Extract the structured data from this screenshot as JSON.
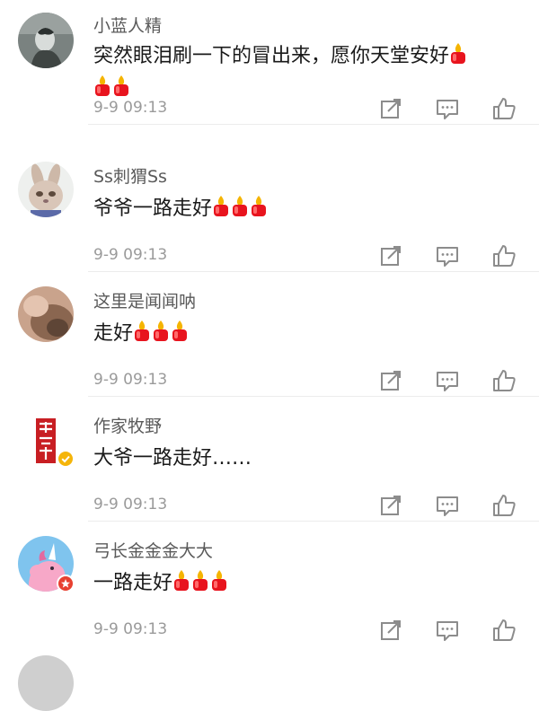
{
  "comments": [
    {
      "username": "小蓝人精",
      "text": "突然眼泪刷一下的冒出来，愿你天堂安好",
      "reaction_icons": [
        "candle-emoji",
        "candle-emoji",
        "candle-emoji"
      ],
      "time": "9-9 09:13",
      "avatar": "dark-photo-avatar"
    },
    {
      "username": "Ss刺猬Ss",
      "text": "爷爷一路走好",
      "reaction_icons": [
        "candle-emoji",
        "candle-emoji",
        "candle-emoji"
      ],
      "time": "9-9 09:13",
      "avatar": "bunny-cartoon-avatar"
    },
    {
      "username": "这里是闻闻呐",
      "text": "走好",
      "reaction_icons": [
        "candle-emoji",
        "candle-emoji",
        "candle-emoji"
      ],
      "time": "9-9 09:13",
      "avatar": "blurred-photo-avatar"
    },
    {
      "username": "作家牧野",
      "text": "大爷一路走好……",
      "reaction_icons": [],
      "time": "9-9 09:13",
      "avatar": "red-calligraphy-avatar",
      "badge": "gold-verified-badge"
    },
    {
      "username": "弓长金金金大大",
      "text": "一路走好",
      "reaction_icons": [
        "candle-emoji",
        "candle-emoji",
        "candle-emoji"
      ],
      "time": "9-9 09:13",
      "avatar": "pink-unicorn-avatar",
      "badge": "red-member-badge"
    }
  ],
  "actions": [
    "share-icon",
    "reply-icon",
    "like-icon"
  ],
  "colors": {
    "username": "#5a5a5a",
    "text": "#1a1a1a",
    "time": "#9a9a9a",
    "icon": "#8c8c8c",
    "divider": "#ececec",
    "candle_flame": "#f5b400",
    "candle_body": "#e8141e",
    "verified_badge": "#f5b50a",
    "member_badge": "#e84030"
  }
}
